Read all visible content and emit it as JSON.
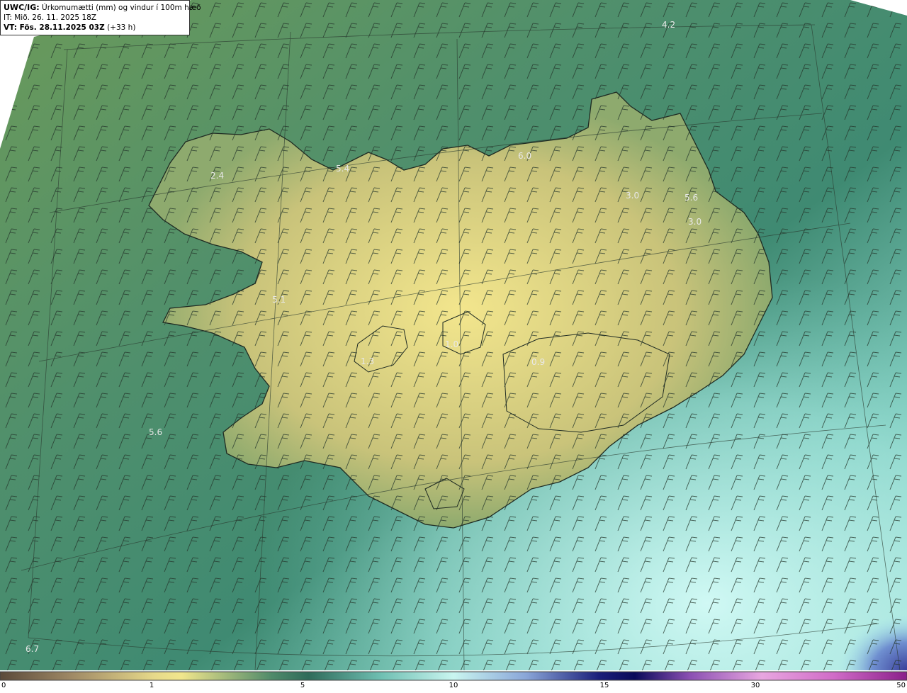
{
  "header": {
    "title_bold": "UWC/IG:",
    "title_rest": " Úrkomumætti (mm) og vindur í 100m hæð",
    "it_line": "IT: Mið. 26. 11. 2025 18Z",
    "vt_bold": "VT: Fös. 28.11.2025 03Z",
    "vt_rest": " (+33 h)"
  },
  "labels": [
    {
      "text": "4.2"
    },
    {
      "text": "5.4"
    },
    {
      "text": "6.0"
    },
    {
      "text": "2.4"
    },
    {
      "text": "3.0"
    },
    {
      "text": "5.6"
    },
    {
      "text": "3.0"
    },
    {
      "text": "5.1"
    },
    {
      "text": "1.0"
    },
    {
      "text": "1.3"
    },
    {
      "text": "0.9"
    },
    {
      "text": "5.6"
    },
    {
      "text": "6.7"
    }
  ],
  "colorbar": {
    "ticks": [
      "0",
      "1",
      "5",
      "10",
      "15",
      "30",
      "50"
    ],
    "colors": [
      "#5b4a3a",
      "#a08a66",
      "#e6d98a",
      "#f1e68c",
      "#4f8a6a",
      "#2f6b5a",
      "#6fbfb2",
      "#c9f5f0",
      "#8aa6d8",
      "#1b1f7a",
      "#0a0a5a",
      "#8a4fb2",
      "#e8a6e0",
      "#d06bc7",
      "#8a1f8a"
    ]
  },
  "style": {
    "sea_color": "#5a9e72",
    "land_color": "#d8cf84",
    "south_sea_color": "#8fd8cc",
    "coast_color": "#1e2a22",
    "label_color": "#e8e8e8"
  }
}
